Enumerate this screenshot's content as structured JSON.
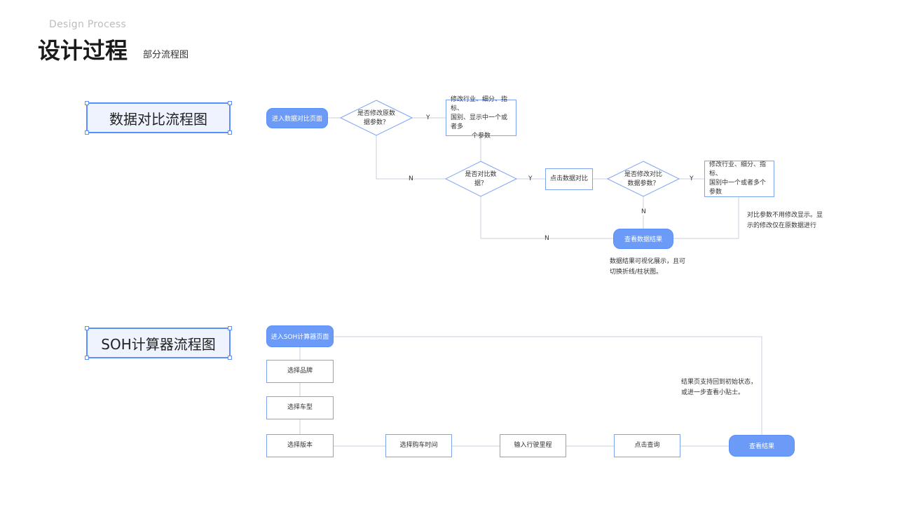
{
  "header": {
    "subtitle_en": "Design Process",
    "title": "设计过程",
    "title_note": "部分流程图"
  },
  "flow1": {
    "label": "数据对比流程图",
    "start": "进入数据对比页面",
    "decision1": "是否修改原数据参数？",
    "decision1_lines": [
      "是否修改原数",
      "据参数？"
    ],
    "action1_lines": [
      "修改行业、细分、指标、",
      "国别、显示中一个或者多",
      "个参数"
    ],
    "decision2_lines": [
      "是否对比数",
      "据？"
    ],
    "action2": "点击数据对比",
    "decision3_lines": [
      "是否修改对比",
      "数据参数？"
    ],
    "action3_lines": [
      "修改行业、细分、指标、",
      "国别中一个或者多个参数"
    ],
    "result": "查看数据结果",
    "note_right_lines": [
      "对比参数不用修改显示。显",
      "示的修改仅在原数据进行"
    ],
    "note_bottom_lines": [
      "数据结果可视化展示，且可",
      "切换折线/柱状图。"
    ],
    "edge_y1": "Y",
    "edge_n1": "N",
    "edge_y2": "Y",
    "edge_y3": "Y",
    "edge_n3": "N",
    "edge_n2": "N"
  },
  "flow2": {
    "label": "SOH计算器流程图",
    "start": "进入SOH计算器页面",
    "step_brand": "选择品牌",
    "step_model": "选择车型",
    "step_version": "选择版本",
    "step_time": "选择购车时间",
    "step_mileage": "输入行驶里程",
    "step_query": "点击查询",
    "result": "查看结果",
    "note_lines": [
      "结果页支持回到初始状态，",
      "或进一步查看小贴士。"
    ]
  }
}
